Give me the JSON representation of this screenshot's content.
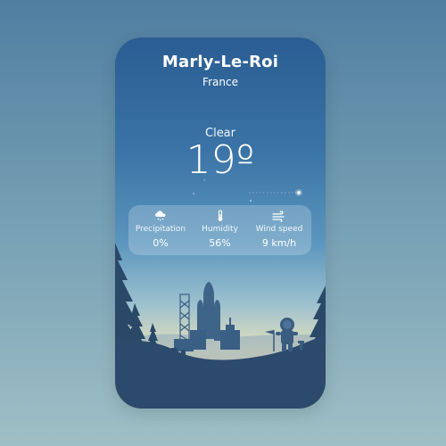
{
  "location": {
    "city": "Marly-Le-Roi",
    "country": "France"
  },
  "weather": {
    "condition": "Clear",
    "temperature": "19º"
  },
  "stats": [
    {
      "icon": "cloud-rain-icon",
      "label": "Precipitation",
      "value": "0%"
    },
    {
      "icon": "thermometer-icon",
      "label": "Humidity",
      "value": "56%"
    },
    {
      "icon": "wind-icon",
      "label": "Wind speed",
      "value": "9 km/h"
    }
  ],
  "colors": {
    "sky_top": "#2a5d93",
    "sky_horizon": "#eddfae",
    "foreground": "#2c4a6b",
    "text": "#ffffff"
  }
}
